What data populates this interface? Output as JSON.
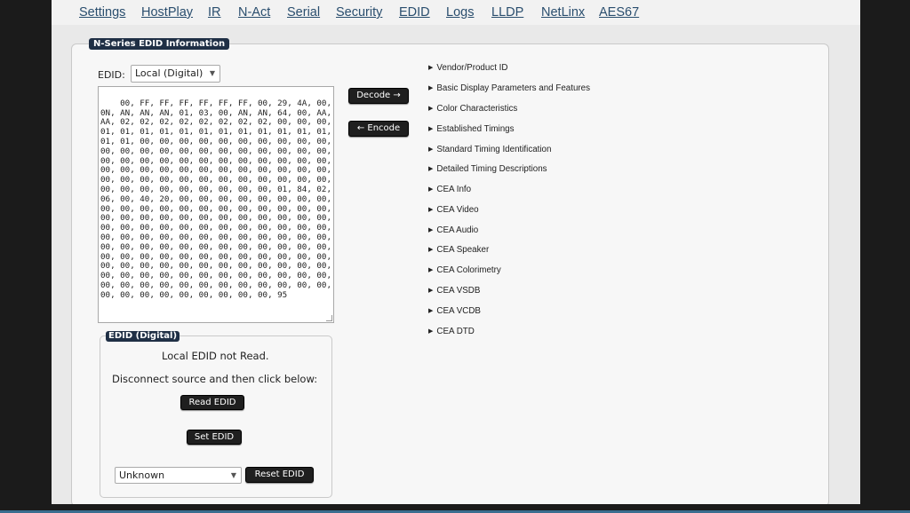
{
  "nav": {
    "items": [
      "Settings",
      "HostPlay",
      "IR",
      "N-Act",
      "Serial",
      "Security",
      "EDID",
      "Logs",
      "LLDP",
      "NetLinx",
      "AES67"
    ]
  },
  "edid_info": {
    "legend": "N-Series EDID Information",
    "edid_label": "EDID:",
    "edid_select_value": "Local (Digital)",
    "hex_text": "00, FF, FF, FF, FF, FF, FF, 00, 29, 4A, 00, 00, 00, 00,\n0N, AN, AN, AN, 01, 03, 00, AN, AN, 64, 00, AA,\nAA, 02, 02, 02, 02, 02, 02, 02, 02, 00, 00, 00, 01,\n01, 01, 01, 01, 01, 01, 01, 01, 01, 01, 01, 01, 01,\n01, 01, 00, 00, 00, 00, 00, 00, 00, 00, 00, 00, 00,\n00, 00, 00, 00, 00, 00, 00, 00, 00, 00, 00, 00, 00,\n00, 00, 00, 00, 00, 00, 00, 00, 00, 00, 00, 00, 00,\n00, 00, 00, 00, 00, 00, 00, 00, 00, 00, 00, 00, 00,\n00, 00, 00, 00, 00, 00, 00, 00, 00, 00, 00, 00, 00,\n00, 00, 00, 00, 00, 00, 00, 00, 00, 01, 84, 02, 03,\n06, 00, 40, 20, 00, 00, 00, 00, 00, 00, 00, 00, 00,\n00, 00, 00, 00, 00, 00, 00, 00, 00, 00, 00, 00, 00,\n00, 00, 00, 00, 00, 00, 00, 00, 00, 00, 00, 00, 00,\n00, 00, 00, 00, 00, 00, 00, 00, 00, 00, 00, 00, 00,\n00, 00, 00, 00, 00, 00, 00, 00, 00, 00, 00, 00, 00,\n00, 00, 00, 00, 00, 00, 00, 00, 00, 00, 00, 00, 00,\n00, 00, 00, 00, 00, 00, 00, 00, 00, 00, 00, 00, 00,\n00, 00, 00, 00, 00, 00, 00, 00, 00, 00, 00, 00, 00,\n00, 00, 00, 00, 00, 00, 00, 00, 00, 00, 00, 00, 00,\n00, 00, 00, 00, 00, 00, 00, 00, 00, 00, 00, 00, 00,\n00, 00, 00, 00, 00, 00, 00, 00, 00, 95",
    "decode_label": "Decode →",
    "encode_label": "← Encode",
    "sections": [
      "Vendor/Product ID",
      "Basic Display Parameters and Features",
      "Color Characteristics",
      "Established Timings",
      "Standard Timing Identification",
      "Detailed Timing Descriptions",
      "CEA Info",
      "CEA Video",
      "CEA Audio",
      "CEA Speaker",
      "CEA Colorimetry",
      "CEA VSDB",
      "CEA VCDB",
      "CEA DTD"
    ]
  },
  "edid_digital": {
    "legend": "EDID (Digital)",
    "status": "Local EDID not Read.",
    "instruction": "Disconnect source and then click below:",
    "read_label": "Read EDID",
    "set_label": "Set EDID",
    "preset_value": "Unknown",
    "reset_label": "Reset EDID"
  },
  "colors": {
    "legend_bg": "#1f2f45",
    "button_bg": "#1f1f1f",
    "nav_link": "#2a4e6e"
  }
}
